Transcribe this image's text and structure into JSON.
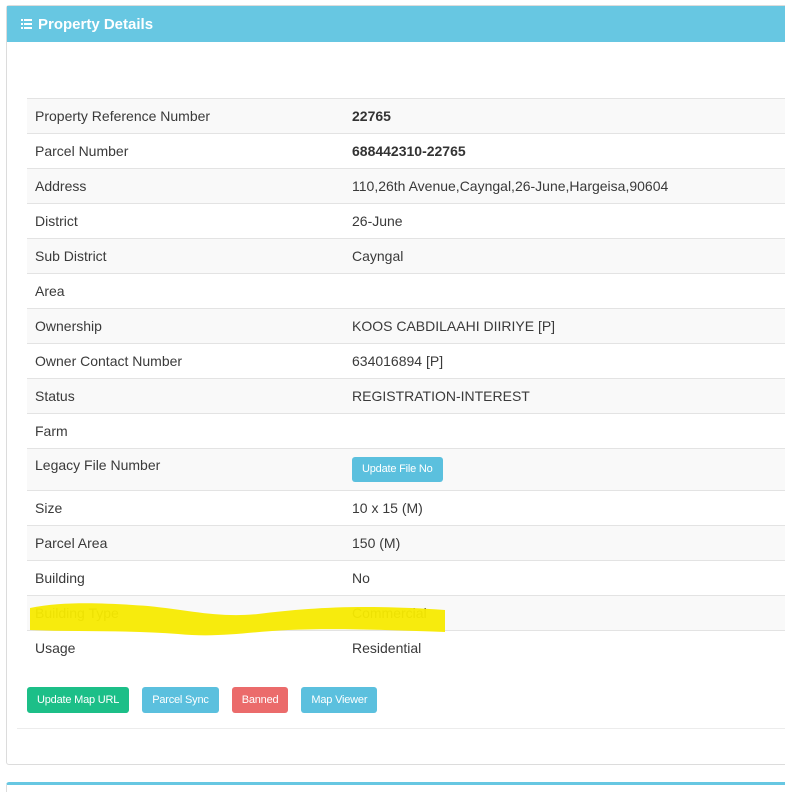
{
  "panel": {
    "title": "Property Details",
    "header_color": "#67c7e2",
    "icon": "list-icon"
  },
  "rows": [
    {
      "label": "Property Reference Number",
      "value": "22765"
    },
    {
      "label": "Parcel Number",
      "value": "688442310-22765"
    },
    {
      "label": "Address",
      "value": "110,26th Avenue,Cayngal,26-June,Hargeisa,90604"
    },
    {
      "label": "District",
      "value": "26-June"
    },
    {
      "label": "Sub District",
      "value": "Cayngal"
    },
    {
      "label": "Area",
      "value": ""
    },
    {
      "label": "Ownership",
      "value": "KOOS CABDILAAHI DIIRIYE [P]"
    },
    {
      "label": "Owner Contact Number",
      "value": "634016894 [P]"
    },
    {
      "label": "Status",
      "value": "REGISTRATION-INTEREST"
    },
    {
      "label": "Farm",
      "value": ""
    },
    {
      "label": "Legacy File Number",
      "button_label": "Update File No"
    },
    {
      "label": "Size",
      "value": "10 x 15 (M)"
    },
    {
      "label": "Parcel Area",
      "value": "150 (M)"
    },
    {
      "label": "Building",
      "value": "No"
    },
    {
      "label": "Building Type",
      "value": "Commercial"
    },
    {
      "label": "Usage",
      "value": "Residential"
    }
  ],
  "actions": {
    "update_map_url": "Update Map URL",
    "parcel_sync": "Parcel Sync",
    "banned": "Banned",
    "map_viewer": "Map Viewer"
  },
  "colors": {
    "info": "#5bc0de",
    "success": "#1cbf88",
    "danger": "#eb6b6b",
    "highlight": "#f7ea00"
  }
}
